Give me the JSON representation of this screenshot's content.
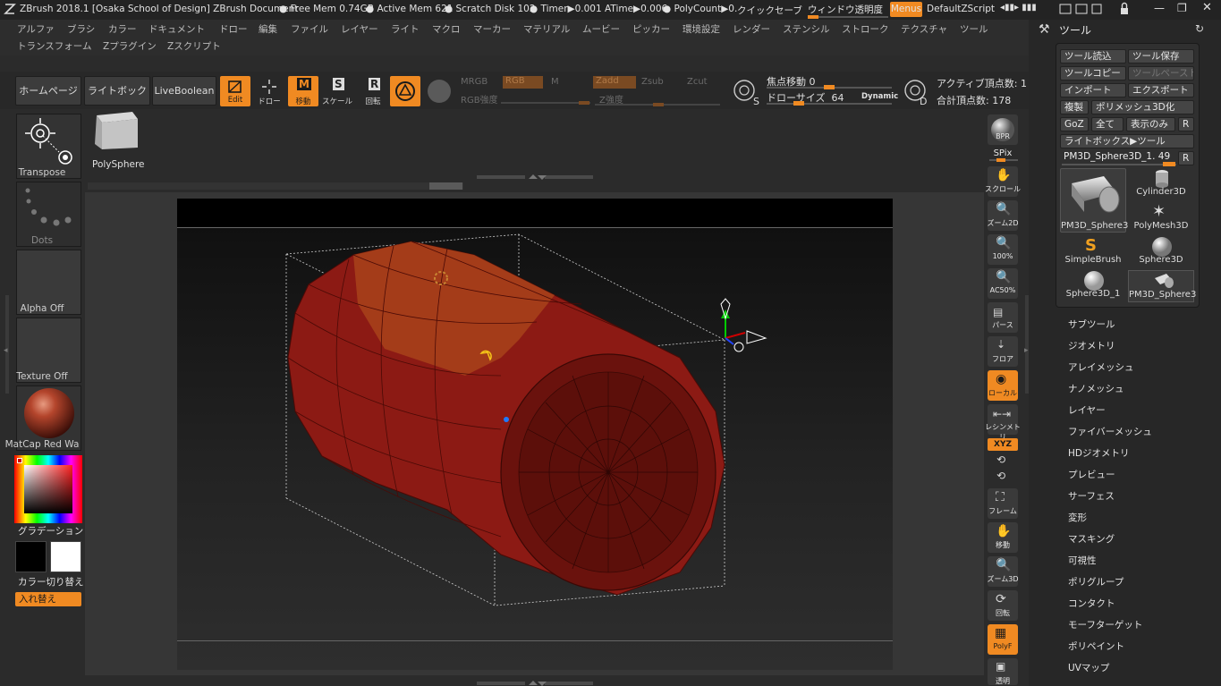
{
  "titlebar": {
    "app_title": "ZBrush 2018.1 [Osaka School of Design]  ZBrush Document",
    "free_mem": "Free Mem 0.74GB",
    "active_mem": "Active Mem 621",
    "scratch_disk": "Scratch Disk 102",
    "timer": "Timer▶0.001 ATime▶0.006",
    "polycount": "PolyCount▶0.",
    "quicksave": "クイックセーブ",
    "window_transparency": "ウィンドウ透明度",
    "menus": "Menus",
    "default_zscript": "DefaultZScript"
  },
  "menus": {
    "row1": [
      "アルファ",
      "ブラシ",
      "カラー",
      "ドキュメント",
      "ドロー",
      "編集",
      "ファイル",
      "レイヤー",
      "ライト",
      "マクロ",
      "マーカー",
      "マテリアル",
      "ムービー",
      "ピッカー",
      "環境設定",
      "レンダー",
      "ステンシル",
      "ストローク",
      "テクスチャ",
      "ツール"
    ],
    "row2": [
      "トランスフォーム",
      "Zプラグイン",
      "Zスクリプト"
    ]
  },
  "topbar": {
    "home_page": "ホームページ",
    "lightbox": "ライトボックス",
    "live_boolean": "LiveBoolean",
    "edit": "Edit",
    "draw": "ドロー",
    "move": "移動",
    "scale": "スケール",
    "rotate": "回転",
    "mrgb": "MRGB",
    "rgb": "RGB",
    "m": "M",
    "rgb_intensity": "RGB強度",
    "zadd": "Zadd",
    "zsub": "Zsub",
    "zcut": "Zcut",
    "z_intensity": "Z強度",
    "focal_shift_label": "焦点移動",
    "focal_shift_value": "0",
    "draw_size_label": "ドローサイズ",
    "draw_size_value": "64",
    "dynamic": "Dynamic",
    "active_points": "アクティブ頂点数: 1",
    "total_points": "合計頂点数: 178"
  },
  "left_panel": {
    "transpose": "Transpose",
    "polysphere": "PolySphere",
    "dots": "Dots",
    "alpha_off": "Alpha Off",
    "texture_off": "Texture Off",
    "matcap": "MatCap Red Wa",
    "gradient": "グラデーション",
    "color_switch": "カラー切り替え",
    "swap": "入れ替え"
  },
  "right_tools": {
    "bpr": "BPR",
    "spix": "SPix",
    "scroll": "スクロール",
    "zoom2d": "ズーム2D",
    "hundred": "100%",
    "ac50": "AC50%",
    "perspective": "パース",
    "floor": "フロア",
    "local": "ローカル",
    "symmetry": "レシンメトリ",
    "xyz": "XYZ",
    "frame": "フレーム",
    "move": "移動",
    "zoom3d": "ズーム3D",
    "rotate": "回転",
    "polyf": "PolyF",
    "transparent": "透明"
  },
  "tool_panel": {
    "title": "ツール",
    "load_tool": "ツール読込",
    "save_tool": "ツール保存",
    "copy_tool": "ツールコピー",
    "paste_tool": "ツールペースト",
    "import": "インポート",
    "export": "エクスポート",
    "clone": "複製",
    "make_polymesh": "ポリメッシュ3D化",
    "goz": "GoZ",
    "all": "全て",
    "visible": "表示のみ",
    "r": "R",
    "lightbox_tools": "ライトボックス▶ツール",
    "current_tool": "PM3D_Sphere3D_1. 49",
    "tools": [
      {
        "name": "PM3D_Sphere3"
      },
      {
        "name": "Cylinder3D"
      },
      {
        "name": "PolyMesh3D"
      },
      {
        "name": "SimpleBrush"
      },
      {
        "name": "Sphere3D"
      },
      {
        "name": "Sphere3D_1"
      },
      {
        "name": "PM3D_Sphere3"
      }
    ],
    "subpalettes": [
      "サブツール",
      "ジオメトリ",
      "アレイメッシュ",
      "ナノメッシュ",
      "レイヤー",
      "ファイバーメッシュ",
      "HDジオメトリ",
      "プレビュー",
      "サーフェス",
      "変形",
      "マスキング",
      "可視性",
      "ポリグループ",
      "コンタクト",
      "モーフターゲット",
      "ポリペイント",
      "UVマップ"
    ]
  },
  "colors": {
    "accent": "#f08a22",
    "mesh_red": "#8c1a14",
    "mesh_orange": "#a8431a",
    "background": "#2b2b2b"
  }
}
